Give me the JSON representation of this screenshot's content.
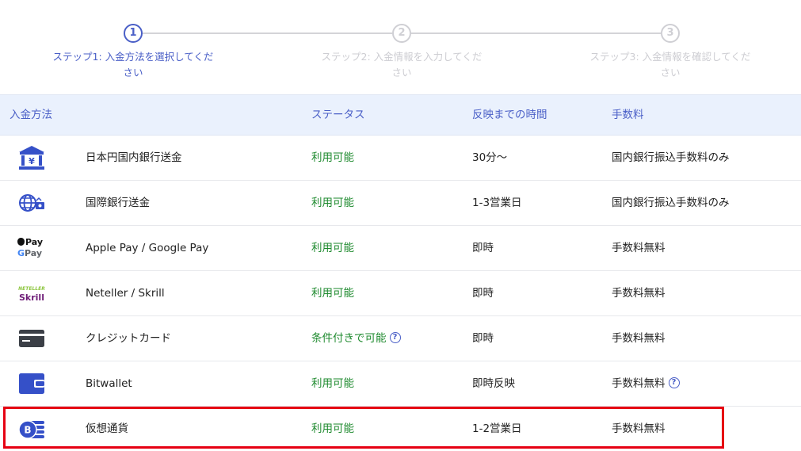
{
  "steps": [
    {
      "num": "1",
      "label": "ステップ1: 入金方法を選択してください",
      "state": "active"
    },
    {
      "num": "2",
      "label": "ステップ2: 入金情報を入力してください",
      "state": "inactive"
    },
    {
      "num": "3",
      "label": "ステップ3: 入金情報を確認してください",
      "state": "inactive"
    }
  ],
  "table": {
    "headers": {
      "method": "入金方法",
      "status": "ステータス",
      "time": "反映までの時間",
      "fee": "手数料"
    },
    "rows": [
      {
        "icon": "bank-icon",
        "name": "日本円国内銀行送金",
        "status": "利用可能",
        "time": "30分〜",
        "fee": "国内銀行振込手数料のみ"
      },
      {
        "icon": "international-transfer-icon",
        "name": "国際銀行送金",
        "status": "利用可能",
        "time": "1-3営業日",
        "fee": "国内銀行振込手数料のみ"
      },
      {
        "icon": "apple-google-pay-icon",
        "name": "Apple Pay / Google Pay",
        "status": "利用可能",
        "time": "即時",
        "fee": "手数料無料"
      },
      {
        "icon": "neteller-skrill-icon",
        "name": "Neteller / Skrill",
        "status": "利用可能",
        "time": "即時",
        "fee": "手数料無料"
      },
      {
        "icon": "credit-card-icon",
        "name": "クレジットカード",
        "status": "条件付きで可能",
        "time": "即時",
        "fee": "手数料無料"
      },
      {
        "icon": "wallet-icon",
        "name": "Bitwallet",
        "status": "利用可能",
        "time": "即時反映",
        "fee": "手数料無料"
      },
      {
        "icon": "crypto-coin-icon",
        "name": "仮想通貨",
        "status": "利用可能",
        "time": "1-2営業日",
        "fee": "手数料無料"
      }
    ]
  },
  "icon_text": {
    "apple_pay": "Pay",
    "google_pay": "Pay",
    "neteller": "NETELLER",
    "skrill": "Skrill",
    "help": "?"
  },
  "colors": {
    "accent": "#4a5fc7",
    "available": "#1e8a2e",
    "header_bg": "#eaf1fd",
    "highlight": "#e60012"
  }
}
